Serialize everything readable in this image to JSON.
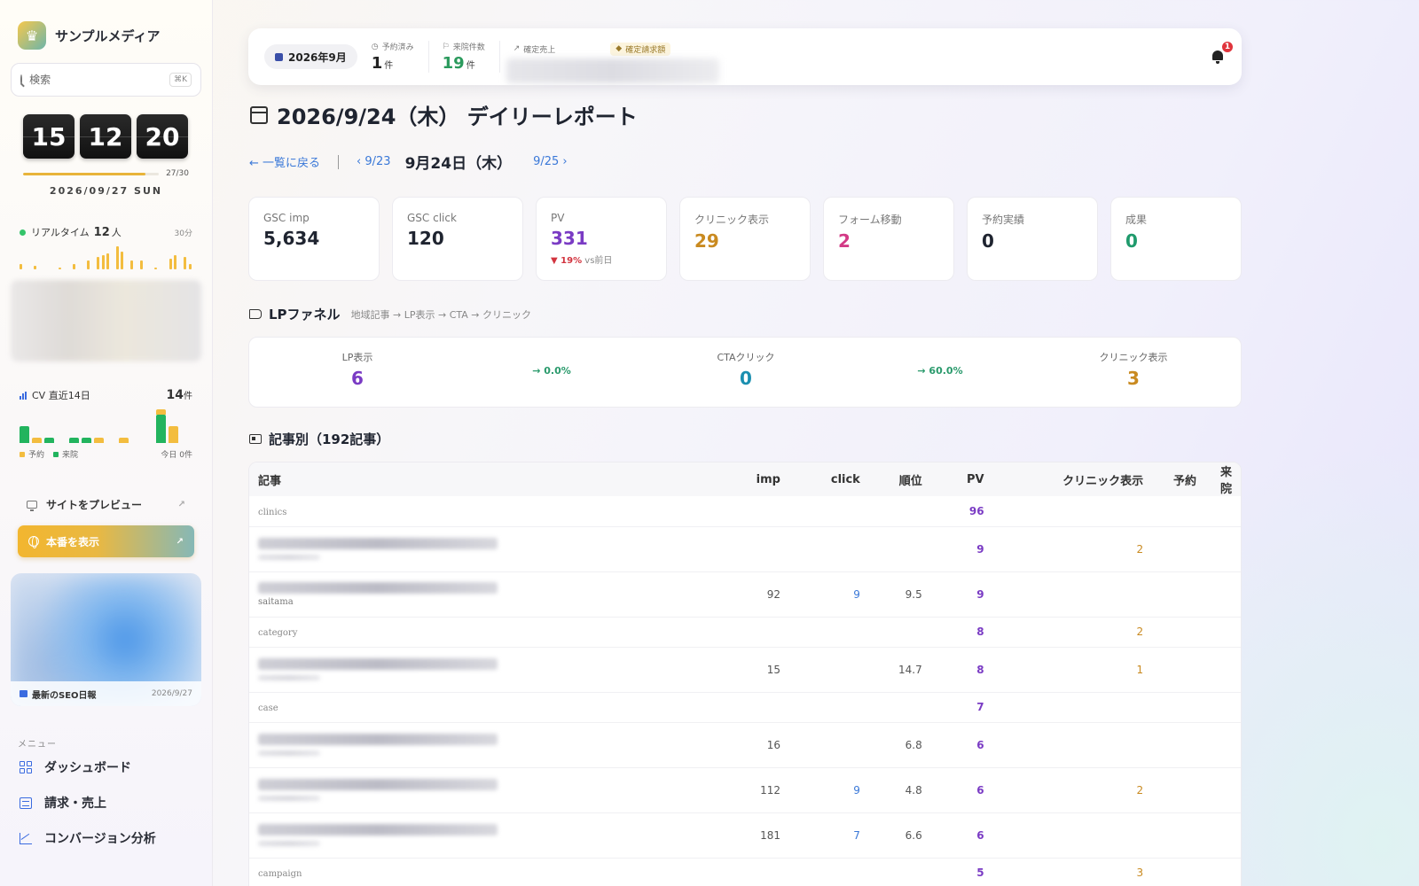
{
  "sidebar": {
    "brand": "サンプルメディア",
    "search_placeholder": "検索",
    "search_shortcut": "⌘K",
    "clock": {
      "h": "15",
      "m": "12",
      "s": "20"
    },
    "progress": {
      "label": "27/30",
      "fraction": 0.9
    },
    "date": "2026/09/27 SUN",
    "realtime": {
      "label": "リアルタイム",
      "count": "12",
      "unit": "人",
      "span": "30分",
      "bars": [
        3,
        0,
        0,
        2,
        0,
        0,
        0,
        0,
        1,
        0,
        0,
        3,
        0,
        0,
        5,
        0,
        7,
        8,
        9,
        0,
        13,
        10,
        0,
        5,
        0,
        5,
        0,
        0,
        1,
        0,
        0,
        6,
        8,
        0,
        7,
        3
      ]
    },
    "cv": {
      "label": "CV 直近14日",
      "total": "14",
      "unit": "件",
      "bars": [
        {
          "reserve": 0,
          "visit": 3
        },
        {
          "reserve": 1,
          "visit": 0
        },
        {
          "reserve": 0,
          "visit": 1
        },
        {
          "reserve": 0,
          "visit": 0
        },
        {
          "reserve": 0,
          "visit": 1
        },
        {
          "reserve": 0,
          "visit": 1
        },
        {
          "reserve": 1,
          "visit": 0
        },
        {
          "reserve": 0,
          "visit": 0
        },
        {
          "reserve": 1,
          "visit": 0
        },
        {
          "reserve": 0,
          "visit": 0
        },
        {
          "reserve": 0,
          "visit": 0
        },
        {
          "reserve": 1,
          "visit": 5
        },
        {
          "reserve": 3,
          "visit": 0
        },
        {
          "reserve": 0,
          "visit": 0
        }
      ],
      "legend_reserve": "予約",
      "legend_visit": "来院",
      "today": "今日 0件"
    },
    "preview_label": "サイトをプレビュー",
    "production_label": "本番を表示",
    "seo_report": {
      "label": "最新のSEO日報",
      "date": "2026/9/27"
    },
    "menu_label": "メニュー",
    "menu": [
      "ダッシュボード",
      "請求・売上",
      "コンバージョン分析"
    ]
  },
  "topbar": {
    "month": "2026年9月",
    "reserved": {
      "label": "予約済み",
      "value": "1",
      "unit": "件"
    },
    "visits": {
      "label": "来院件数",
      "value": "19",
      "unit": "件"
    },
    "sales": {
      "label": "確定売上"
    },
    "billing": {
      "label": "確定請求額"
    },
    "notifications": "1"
  },
  "page": {
    "title": "2026/9/24（木） デイリーレポート",
    "back": "← 一覧に戻る",
    "prev": "9/23",
    "current": "9月24日（木）",
    "next": "9/25"
  },
  "kpis": [
    {
      "label": "GSC imp",
      "value": "5,634",
      "color": "#1f2430"
    },
    {
      "label": "GSC click",
      "value": "120",
      "color": "#1f2430"
    },
    {
      "label": "PV",
      "value": "331",
      "color": "#7a3bc4",
      "delta": "19%",
      "delta_suffix": " vs前日"
    },
    {
      "label": "クリニック表示",
      "value": "29",
      "color": "#c98a20"
    },
    {
      "label": "フォーム移動",
      "value": "2",
      "color": "#d33a86"
    },
    {
      "label": "予約実績",
      "value": "0",
      "color": "#1f2430"
    },
    {
      "label": "成果",
      "value": "0",
      "color": "#1f9a6c"
    }
  ],
  "funnel": {
    "title": "LPファネル",
    "subtitle": "地域記事 → LP表示 → CTA → クリニック",
    "steps": [
      {
        "label": "LP表示",
        "value": "6",
        "color": "#7a3bc4"
      },
      {
        "label": "CTAクリック",
        "value": "0",
        "color": "#1a8fb0"
      },
      {
        "label": "クリニック表示",
        "value": "3",
        "color": "#c98a20"
      }
    ],
    "rates": [
      "→ 0.0%",
      "→ 60.0%"
    ]
  },
  "articles": {
    "title": "記事別（192記事）",
    "headers": [
      "記事",
      "imp",
      "click",
      "順位",
      "PV",
      "クリニック表示",
      "予約",
      "来院"
    ],
    "rows": [
      {
        "kind": "cat",
        "label": "clinics",
        "pv": "96",
        "clinic": ""
      },
      {
        "kind": "art",
        "sub": "",
        "imp": "",
        "click": "",
        "rank": "",
        "pv": "9",
        "clinic": "2"
      },
      {
        "kind": "art",
        "sub": "saitama",
        "imp": "92",
        "click": "9",
        "rank": "9.5",
        "pv": "9",
        "clinic": ""
      },
      {
        "kind": "cat",
        "label": "category",
        "pv": "8",
        "clinic": "2"
      },
      {
        "kind": "art",
        "sub": "",
        "imp": "15",
        "click": "",
        "rank": "14.7",
        "pv": "8",
        "clinic": "1"
      },
      {
        "kind": "cat",
        "label": "case",
        "pv": "7",
        "clinic": ""
      },
      {
        "kind": "art",
        "sub": "",
        "imp": "16",
        "click": "",
        "rank": "6.8",
        "pv": "6",
        "clinic": ""
      },
      {
        "kind": "art",
        "sub": "",
        "imp": "112",
        "click": "9",
        "rank": "4.8",
        "pv": "6",
        "clinic": "2"
      },
      {
        "kind": "art",
        "sub": "",
        "imp": "181",
        "click": "7",
        "rank": "6.6",
        "pv": "6",
        "clinic": ""
      },
      {
        "kind": "cat",
        "label": "campaign",
        "pv": "5",
        "clinic": "3"
      }
    ]
  }
}
